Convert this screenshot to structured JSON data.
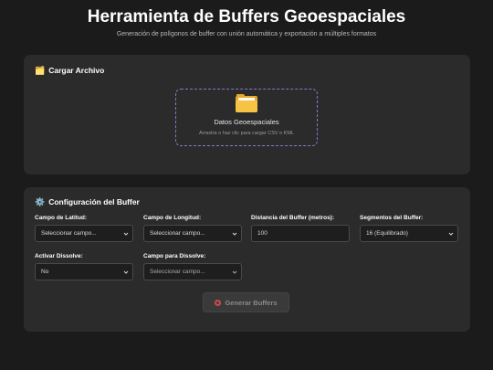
{
  "header": {
    "title": "Herramienta de Buffers Geoespaciales",
    "subtitle": "Generación de polígonos de buffer con unión automática y exportación a múltiples formatos"
  },
  "upload": {
    "icon": "card-file-box-icon",
    "title": "Cargar Archivo",
    "dropzone_icon": "folder-icon",
    "dropzone_title": "Datos Geoespaciales",
    "dropzone_hint": "Arrastra o haz clic para cargar CSV o KML"
  },
  "config": {
    "icon": "gear-icon",
    "title": "Configuración del Buffer",
    "latitude_label": "Campo de Latitud:",
    "latitude_value": "Seleccionar campo...",
    "longitude_label": "Campo de Longitud:",
    "longitude_value": "Seleccionar campo...",
    "distance_label": "Distancia del Buffer (metros):",
    "distance_value": "100",
    "segments_label": "Segmentos del Buffer:",
    "segments_value": "16 (Equilibrado)",
    "dissolve_label": "Activar Dissolve:",
    "dissolve_value": "No",
    "dissolve_field_label": "Campo para Dissolve:",
    "dissolve_field_value": "Seleccionar campo...",
    "generate_label": "Generar Buffers",
    "generate_icon": "target-icon"
  },
  "colors": {
    "background": "#1b1b1b",
    "card": "#2b2b2b",
    "dropzone_border": "#8a77c9"
  }
}
